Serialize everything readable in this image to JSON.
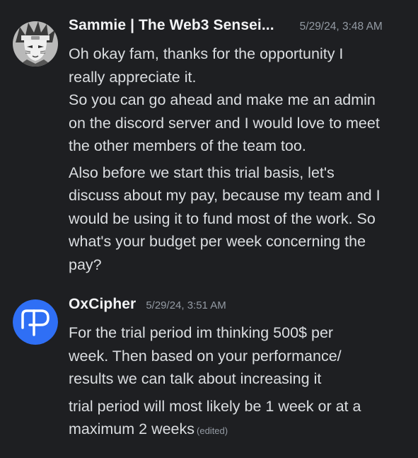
{
  "messages": [
    {
      "author": "Sammie | The Web3 Sensei...",
      "timestamp": "5/29/24, 3:48 AM",
      "avatar_icon": "anime-character-avatar",
      "paragraphs": [
        "Oh okay fam, thanks for the opportunity I\nreally appreciate it.\nSo you can go ahead and make me an admin\non the discord server and I would love to meet\nthe other members of the team too.",
        "Also before we start this trial basis, let's\ndiscuss about my pay, because my team and I\nwould be using it to fund most of the work. So\nwhat's your budget per week concerning the\npay?"
      ]
    },
    {
      "author": "OxCipher",
      "timestamp": "5/29/24, 3:51 AM",
      "avatar_icon": "blue-p-logo-avatar",
      "accent_color": "#2f6ff5",
      "paragraphs": [
        "For the trial period im thinking 500$ per\nweek. Then based on your performance/\nresults we can talk about increasing it",
        "trial period will most likely be 1 week or at a\nmaximum 2 weeks"
      ],
      "edited_label": "(edited)"
    }
  ]
}
